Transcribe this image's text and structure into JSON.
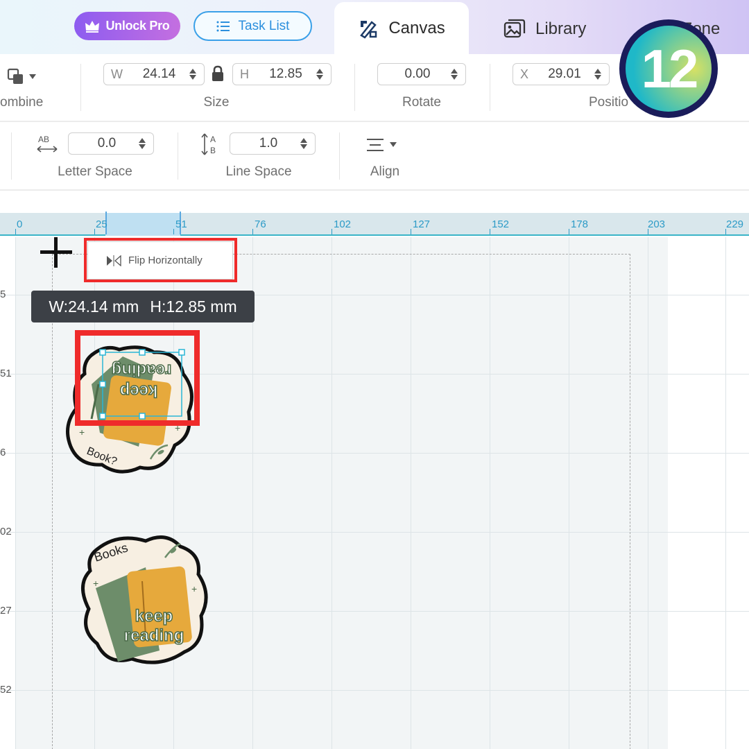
{
  "header": {
    "unlock_pro": "Unlock Pro",
    "task_list": "Task List",
    "tabs": [
      {
        "label": "Canvas",
        "active": true
      },
      {
        "label": "Library",
        "active": false
      },
      {
        "label": "My Zone",
        "active": false
      }
    ]
  },
  "toolbar1": {
    "combine_label": "ombine",
    "size_label": "Size",
    "width_prefix": "W",
    "width_value": "24.14",
    "height_prefix": "H",
    "height_value": "12.85",
    "rotate_label": "Rotate",
    "rotate_value": "0.00",
    "position_label": "Positio",
    "x_prefix": "X",
    "x_value": "29.01"
  },
  "toolbar2": {
    "letter_space_label": "Letter Space",
    "letter_space_value": "0.0",
    "line_space_label": "Line Space",
    "line_space_value": "1.0",
    "align_label": "Align"
  },
  "ruler": {
    "ticks": [
      "0",
      "25",
      "51",
      "76",
      "102",
      "127",
      "152",
      "178",
      "203",
      "229"
    ],
    "vertical": [
      "5",
      "51",
      "6",
      "02",
      "27",
      "52"
    ]
  },
  "canvas": {
    "flip_label": "Flip Horizontally",
    "dim_width": "W:24.14 mm",
    "dim_height": "H:12.85 mm",
    "sticker1_text_top": "keep",
    "sticker1_text_bottom": "reading",
    "sticker1_label": "Book?",
    "sticker2_label": "Books",
    "sticker2_text_top": "keep",
    "sticker2_text_bottom": "reading"
  },
  "badge": {
    "number": "12"
  },
  "colors": {
    "accent_blue": "#2b8fdd",
    "pro_purple": "#8d5cf0",
    "highlight_red": "#ef2b2b",
    "ruler_teal": "#2c9bc7"
  }
}
